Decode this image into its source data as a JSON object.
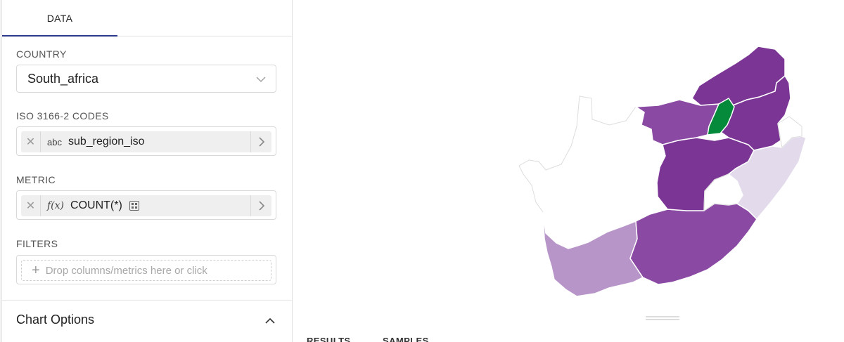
{
  "tabs": [
    {
      "label": "DATA"
    }
  ],
  "fields": {
    "country": {
      "label": "COUNTRY",
      "value": "South_africa"
    },
    "iso_codes": {
      "label": "ISO 3166-2 CODES",
      "type_label": "abc",
      "value": "sub_region_iso"
    },
    "metric": {
      "label": "METRIC",
      "type_label": "f(x)",
      "value": "COUNT(*)"
    },
    "filters": {
      "label": "FILTERS",
      "placeholder": "Drop columns/metrics here or click"
    }
  },
  "chart_options": {
    "label": "Chart Options"
  },
  "map": {
    "colors": {
      "dark_purple": "#7b3594",
      "mid_purple": "#8a4aa3",
      "light_purple": "#b895c9",
      "pale_purple": "#e3dbeb",
      "highlight_green": "#058a3c",
      "border": "#ffffff"
    }
  },
  "results_tabs": [
    {
      "label": "RESULTS"
    },
    {
      "label": "SAMPLES"
    }
  ]
}
